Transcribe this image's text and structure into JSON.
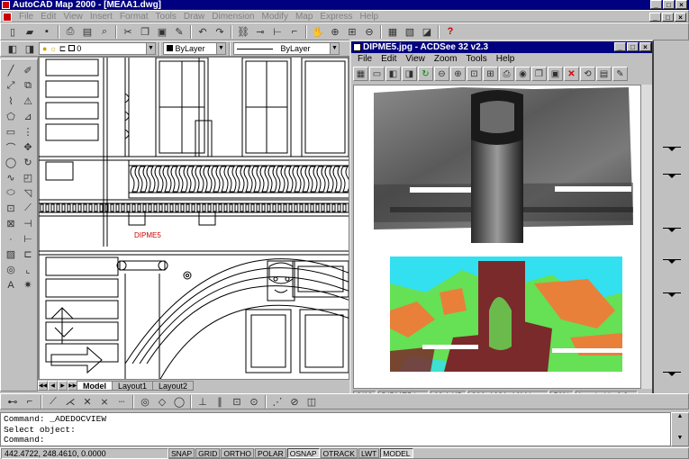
{
  "autocad": {
    "title": "AutoCAD Map 2000 - [ΜΕΛΑ1.dwg]",
    "menu": [
      "File",
      "Edit",
      "View",
      "Insert",
      "Format",
      "Tools",
      "Draw",
      "Dimension",
      "Modify",
      "Map",
      "Express",
      "Help"
    ],
    "layer_value": "0",
    "color_value": "ByLayer",
    "linetype_value": "ByLayer",
    "drawing_label": "DIPME5",
    "layout_tabs": [
      "Model",
      "Layout1",
      "Layout2"
    ],
    "command_lines": [
      "Command:  _ADEDOCVIEW",
      "Select object:",
      "Command:"
    ],
    "coords": "442.4722, 248.4610, 0.0000",
    "status_buttons": [
      "SNAP",
      "GRID",
      "ORTHO",
      "POLAR",
      "OSNAP",
      "OTRACK",
      "LWT",
      "MODEL"
    ],
    "status_on": [
      "OSNAP",
      "MODEL"
    ]
  },
  "acdsee": {
    "title": "DIPME5.jpg - ACDSee 32 v2.3",
    "menu": [
      "File",
      "Edit",
      "View",
      "Zoom",
      "Tools",
      "Help"
    ],
    "status": [
      "2/10",
      "DIPME5.jpg",
      "62.1 KB",
      "806x1031x16M jpeg",
      "50%",
      "Loaded in 0.3 s"
    ]
  },
  "colors": {
    "title_bar": "#000080",
    "classified_cyan": "#33e0f0",
    "classified_green": "#66e055",
    "classified_orange": "#e8803a",
    "classified_brown": "#7a2a2a"
  }
}
